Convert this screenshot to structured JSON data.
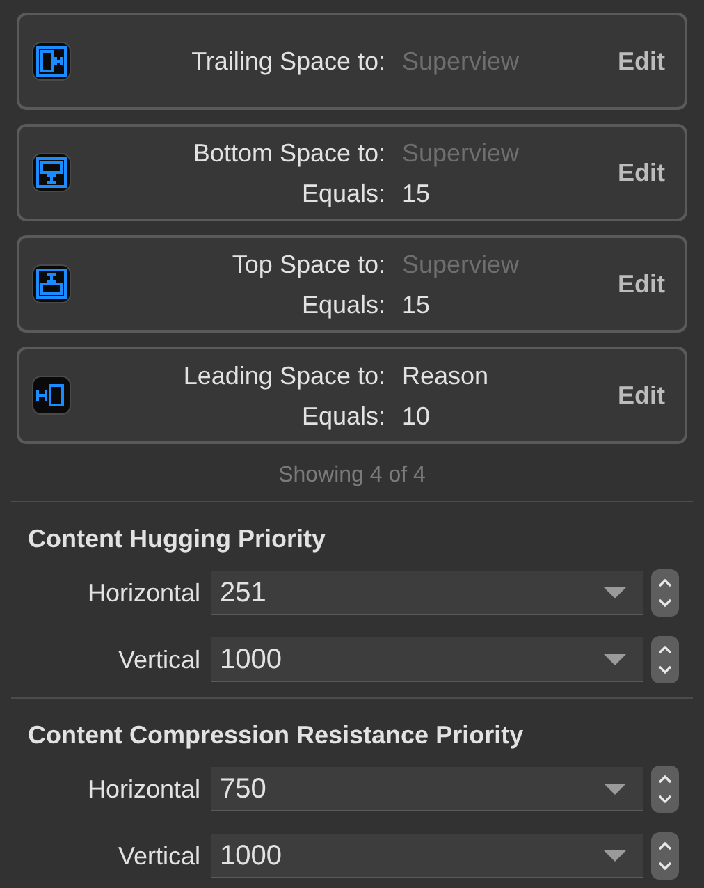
{
  "constraints": [
    {
      "kind": "trailing",
      "lines": [
        {
          "label": "Trailing Space to:",
          "value": "Superview",
          "dimmed": true
        }
      ],
      "action": "Edit"
    },
    {
      "kind": "bottom",
      "lines": [
        {
          "label": "Bottom Space to:",
          "value": "Superview",
          "dimmed": true
        },
        {
          "label": "Equals:",
          "value": "15",
          "dimmed": false
        }
      ],
      "action": "Edit"
    },
    {
      "kind": "top",
      "lines": [
        {
          "label": "Top Space to:",
          "value": "Superview",
          "dimmed": true
        },
        {
          "label": "Equals:",
          "value": "15",
          "dimmed": false
        }
      ],
      "action": "Edit"
    },
    {
      "kind": "leading",
      "lines": [
        {
          "label": "Leading Space to:",
          "value": "Reason",
          "dimmed": false
        },
        {
          "label": "Equals:",
          "value": "10",
          "dimmed": false
        }
      ],
      "action": "Edit"
    }
  ],
  "showing": "Showing 4 of 4",
  "sections": [
    {
      "title": "Content Hugging Priority",
      "rows": [
        {
          "label": "Horizontal",
          "value": "251"
        },
        {
          "label": "Vertical",
          "value": "1000"
        }
      ]
    },
    {
      "title": "Content Compression Resistance Priority",
      "rows": [
        {
          "label": "Horizontal",
          "value": "750"
        },
        {
          "label": "Vertical",
          "value": "1000"
        }
      ]
    }
  ]
}
